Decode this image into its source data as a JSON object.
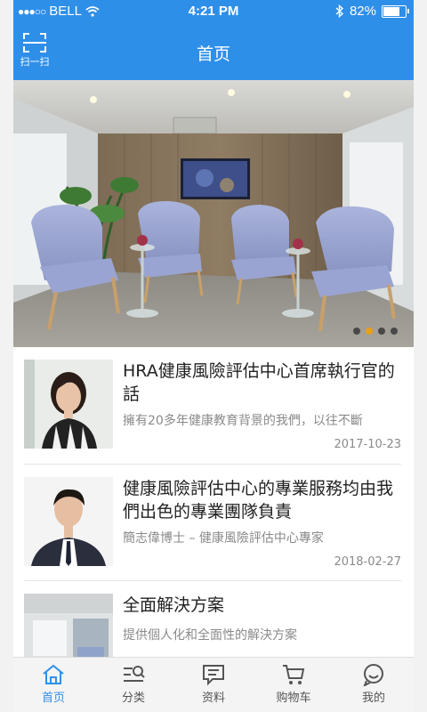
{
  "status_bar": {
    "carrier": "BELL",
    "time": "4:21 PM",
    "battery": "82%",
    "battery_level": 0.82
  },
  "header": {
    "title": "首页",
    "scan_label": "扫一扫"
  },
  "banner": {
    "indicator_count": 4,
    "active_index": 1
  },
  "articles": [
    {
      "title": "HRA健康風險評估中心首席執行官的話",
      "desc": "擁有20多年健康教育背景的我們，以往不斷",
      "date": "2017-10-23"
    },
    {
      "title": "健康風險評估中心的專業服務均由我們出色的專業團隊負責",
      "desc": "簡志偉博士 – 健康風險評估中心專家",
      "date": "2018-02-27"
    },
    {
      "title": "全面解決方案",
      "desc": "提供個人化和全面性的解決方案",
      "date": ""
    }
  ],
  "tabs": [
    {
      "label": "首页",
      "icon": "home-icon",
      "active": true
    },
    {
      "label": "分类",
      "icon": "category-search-icon",
      "active": false
    },
    {
      "label": "资料",
      "icon": "message-icon",
      "active": false
    },
    {
      "label": "购物车",
      "icon": "cart-icon",
      "active": false
    },
    {
      "label": "我的",
      "icon": "profile-icon",
      "active": false
    }
  ],
  "colors": {
    "brand": "#2e8fe9",
    "indicator_active": "#f5a000"
  }
}
